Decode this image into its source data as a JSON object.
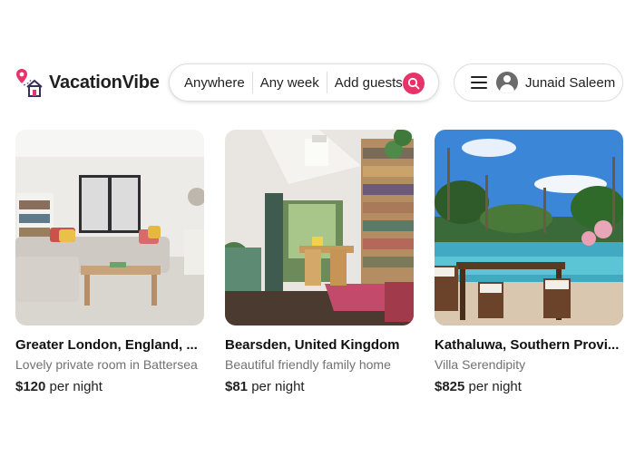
{
  "app": {
    "name": "VacationVibe",
    "brand_color": "#e8336a"
  },
  "search": {
    "location": "Anywhere",
    "dates": "Any week",
    "guests": "Add guests",
    "icon": "search-icon"
  },
  "user_menu": {
    "icon": "menu-icon",
    "avatar_icon": "user-avatar-icon",
    "name": "Junaid Saleem"
  },
  "listings": [
    {
      "title": "Greater London, England, ...",
      "description": "Lovely private room in Battersea",
      "price": "$120",
      "price_suffix": " per night"
    },
    {
      "title": "Bearsden, United Kingdom",
      "description": "Beautiful friendly family home",
      "price": "$81",
      "price_suffix": " per night"
    },
    {
      "title": "Kathaluwa, Southern Provi...",
      "description": "Villa Serendipity",
      "price": "$825",
      "price_suffix": " per night"
    }
  ]
}
